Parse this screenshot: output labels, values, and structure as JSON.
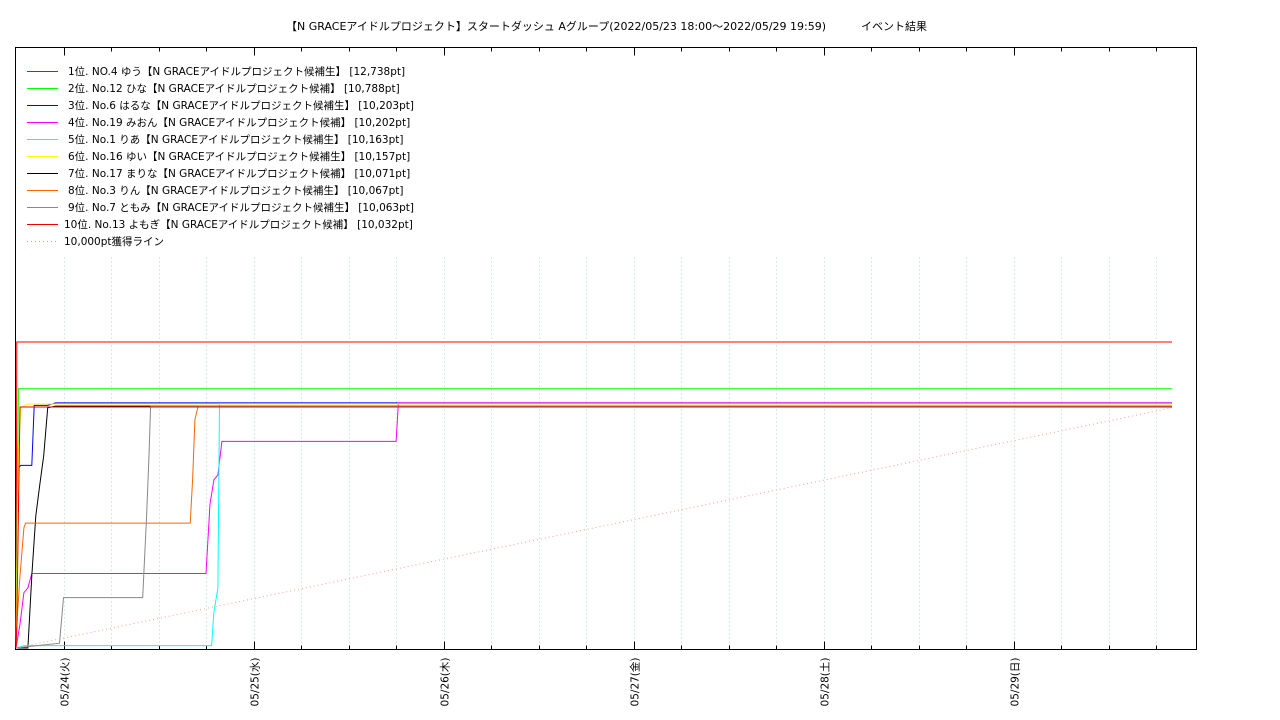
{
  "chart_data": {
    "type": "line",
    "title": "【N GRACEアイドルプロジェクト】スタートダッシュ Aグループ(2022/05/23 18:00〜2022/05/29 19:59)",
    "subtitle": "イベント結果",
    "x_unit": "hours since 2022/05/23 18:00",
    "xlim": [
      0,
      146
    ],
    "ylim": [
      0,
      15000
    ],
    "grid": true,
    "legend_position": "top-left",
    "x_tick_labels": [
      {
        "x": 6,
        "label": "05/24(火)"
      },
      {
        "x": 30,
        "label": "05/25(水)"
      },
      {
        "x": 54,
        "label": "05/26(木)"
      },
      {
        "x": 78,
        "label": "05/27(金)"
      },
      {
        "x": 102,
        "label": "05/28(土)"
      },
      {
        "x": 126,
        "label": "05/29(日)"
      }
    ],
    "series": [
      {
        "name": "1位. NO.4 ゆう【N GRACEアイドルプロジェクト候補生】 [12,738pt]",
        "color": "#ff0000",
        "dash": "",
        "points": [
          [
            0,
            0
          ],
          [
            0.1,
            12738
          ],
          [
            146,
            12738
          ]
        ]
      },
      {
        "name": "2位. No.12 ひな【N GRACEアイドルプロジェクト候補】 [10,788pt]",
        "color": "#00ff00",
        "dash": "",
        "points": [
          [
            0,
            0
          ],
          [
            0.3,
            10788
          ],
          [
            146,
            10788
          ]
        ]
      },
      {
        "name": "3位. No.6 はるな【N GRACEアイドルプロジェクト候補生】 [10,203pt]",
        "color": "#0000ff",
        "dash": "",
        "points": [
          [
            0,
            0
          ],
          [
            0.3,
            7500
          ],
          [
            0.6,
            7600
          ],
          [
            2,
            7600
          ],
          [
            2.3,
            10100
          ],
          [
            4,
            10100
          ],
          [
            5,
            10203
          ],
          [
            146,
            10203
          ]
        ]
      },
      {
        "name": "4位. No.19 みおん【N GRACEアイドルプロジェクト候補】 [10,202pt]",
        "color": "#ff00ff",
        "dash": "",
        "points": [
          [
            0,
            0
          ],
          [
            0.5,
            1000
          ],
          [
            1,
            2300
          ],
          [
            1.5,
            2500
          ],
          [
            2,
            3100
          ],
          [
            2.3,
            3100
          ],
          [
            24,
            3100
          ],
          [
            24.5,
            6000
          ],
          [
            25,
            7000
          ],
          [
            25.5,
            7200
          ],
          [
            26,
            8600
          ],
          [
            48,
            8600
          ],
          [
            48.3,
            10202
          ],
          [
            146,
            10202
          ]
        ]
      },
      {
        "name": "5位. No.1 りあ【N GRACEアイドルプロジェクト候補生】 [10,163pt]",
        "color": "#00ffff",
        "dash": "",
        "points": [
          [
            0,
            0
          ],
          [
            1,
            100
          ],
          [
            24.7,
            100
          ],
          [
            25,
            1500
          ],
          [
            25.5,
            2500
          ],
          [
            25.7,
            10163
          ],
          [
            146,
            10163
          ]
        ]
      },
      {
        "name": "6位. No.16 ゆい【N GRACEアイドルプロジェクト候補生】 [10,157pt]",
        "color": "#ffff00",
        "dash": "",
        "points": [
          [
            0,
            0
          ],
          [
            0.3,
            8000
          ],
          [
            0.6,
            10000
          ],
          [
            1.5,
            10157
          ],
          [
            146,
            10157
          ]
        ]
      },
      {
        "name": "7位. No.17 まりな【N GRACEアイドルプロジェクト候補】 [10,071pt]",
        "color": "#000000",
        "dash": "",
        "points": [
          [
            0,
            0
          ],
          [
            1.5,
            0
          ],
          [
            2,
            3000
          ],
          [
            2.5,
            5500
          ],
          [
            3,
            6800
          ],
          [
            3.5,
            8000
          ],
          [
            4,
            10000
          ],
          [
            5,
            10071
          ],
          [
            146,
            10071
          ]
        ]
      },
      {
        "name": "8位. No.3 りん【N GRACEアイドルプロジェクト候補生】 [10,067pt]",
        "color": "#ff6600",
        "dash": "",
        "points": [
          [
            0,
            0
          ],
          [
            0.2,
            1500
          ],
          [
            0.5,
            3000
          ],
          [
            1,
            5000
          ],
          [
            1.2,
            5200
          ],
          [
            22,
            5200
          ],
          [
            22.3,
            7000
          ],
          [
            22.6,
            9500
          ],
          [
            23,
            10067
          ],
          [
            146,
            10067
          ]
        ]
      },
      {
        "name": "9位. No.7 ともみ【N GRACEアイドルプロジェクト候補生】 [10,063pt]",
        "color": "#888888",
        "dash": "",
        "points": [
          [
            0,
            0
          ],
          [
            5.5,
            200
          ],
          [
            6,
            2100
          ],
          [
            16,
            2100
          ],
          [
            16.2,
            3500
          ],
          [
            16.5,
            5500
          ],
          [
            16.8,
            8000
          ],
          [
            17,
            10063
          ],
          [
            146,
            10063
          ]
        ]
      },
      {
        "name": "10位. No.13 よもぎ【N GRACEアイドルプロジェクト候補】 [10,032pt]",
        "color": "#ee0000",
        "dash": "",
        "points": [
          [
            0,
            0
          ],
          [
            0.1,
            1000
          ],
          [
            0.5,
            10032
          ],
          [
            146,
            10032
          ]
        ]
      },
      {
        "name": "10,000pt獲得ライン",
        "color": "#ff9999",
        "dash": "1,3",
        "points": [
          [
            0,
            0
          ],
          [
            146,
            10000
          ]
        ]
      }
    ]
  }
}
